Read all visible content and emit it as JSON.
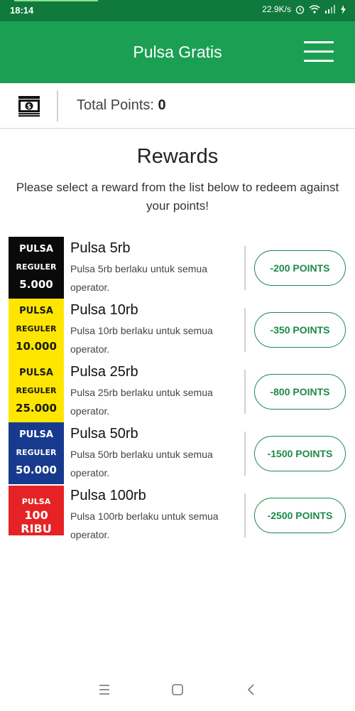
{
  "status_bar": {
    "time": "18:14",
    "net_speed": "22.9K/s"
  },
  "app_bar": {
    "title": "Pulsa Gratis",
    "menu_icon": "hamburger-menu-icon"
  },
  "points": {
    "label": "Total Points: ",
    "value": "0",
    "icon": "money-stack-icon"
  },
  "rewards": {
    "title": "Rewards",
    "description": "Please select a reward from the list below to redeem against your points!",
    "items": [
      {
        "thumb": {
          "line1": "PULSA",
          "line2": "REGULER",
          "line3": "5.000",
          "style": "black"
        },
        "name": "Pulsa 5rb",
        "description": "Pulsa 5rb berlaku untuk semua operator.",
        "button": "-200 POINTS"
      },
      {
        "thumb": {
          "line1": "PULSA",
          "line2": "REGULER",
          "line3": "10.000",
          "style": "yellow"
        },
        "name": "Pulsa 10rb",
        "description": "Pulsa 10rb berlaku untuk semua operator.",
        "button": "-350 POINTS"
      },
      {
        "thumb": {
          "line1": "PULSA",
          "line2": "REGULER",
          "line3": "25.000",
          "style": "yellow"
        },
        "name": "Pulsa 25rb",
        "description": "Pulsa 25rb berlaku untuk semua operator.",
        "button": "-800 POINTS"
      },
      {
        "thumb": {
          "line1": "PULSA",
          "line2": "REGULER",
          "line3": "50.000",
          "style": "blue"
        },
        "name": "Pulsa 50rb",
        "description": "Pulsa 50rb berlaku untuk semua operator.",
        "button": "-1500 POINTS"
      },
      {
        "thumb": {
          "line1": "PULSA",
          "line2": "100 RIBU",
          "line3": "",
          "style": "red"
        },
        "name": "Pulsa 100rb",
        "description": "Pulsa 100rb berlaku untuk semua operator.",
        "button": "-2500 POINTS"
      }
    ]
  },
  "nav_bar": {
    "recents_icon": "recents-icon",
    "home_icon": "home-icon",
    "back_icon": "back-icon"
  },
  "colors": {
    "status_bar": "#0f7a3c",
    "app_bar": "#1ba053",
    "accent": "#1b8a4a"
  }
}
